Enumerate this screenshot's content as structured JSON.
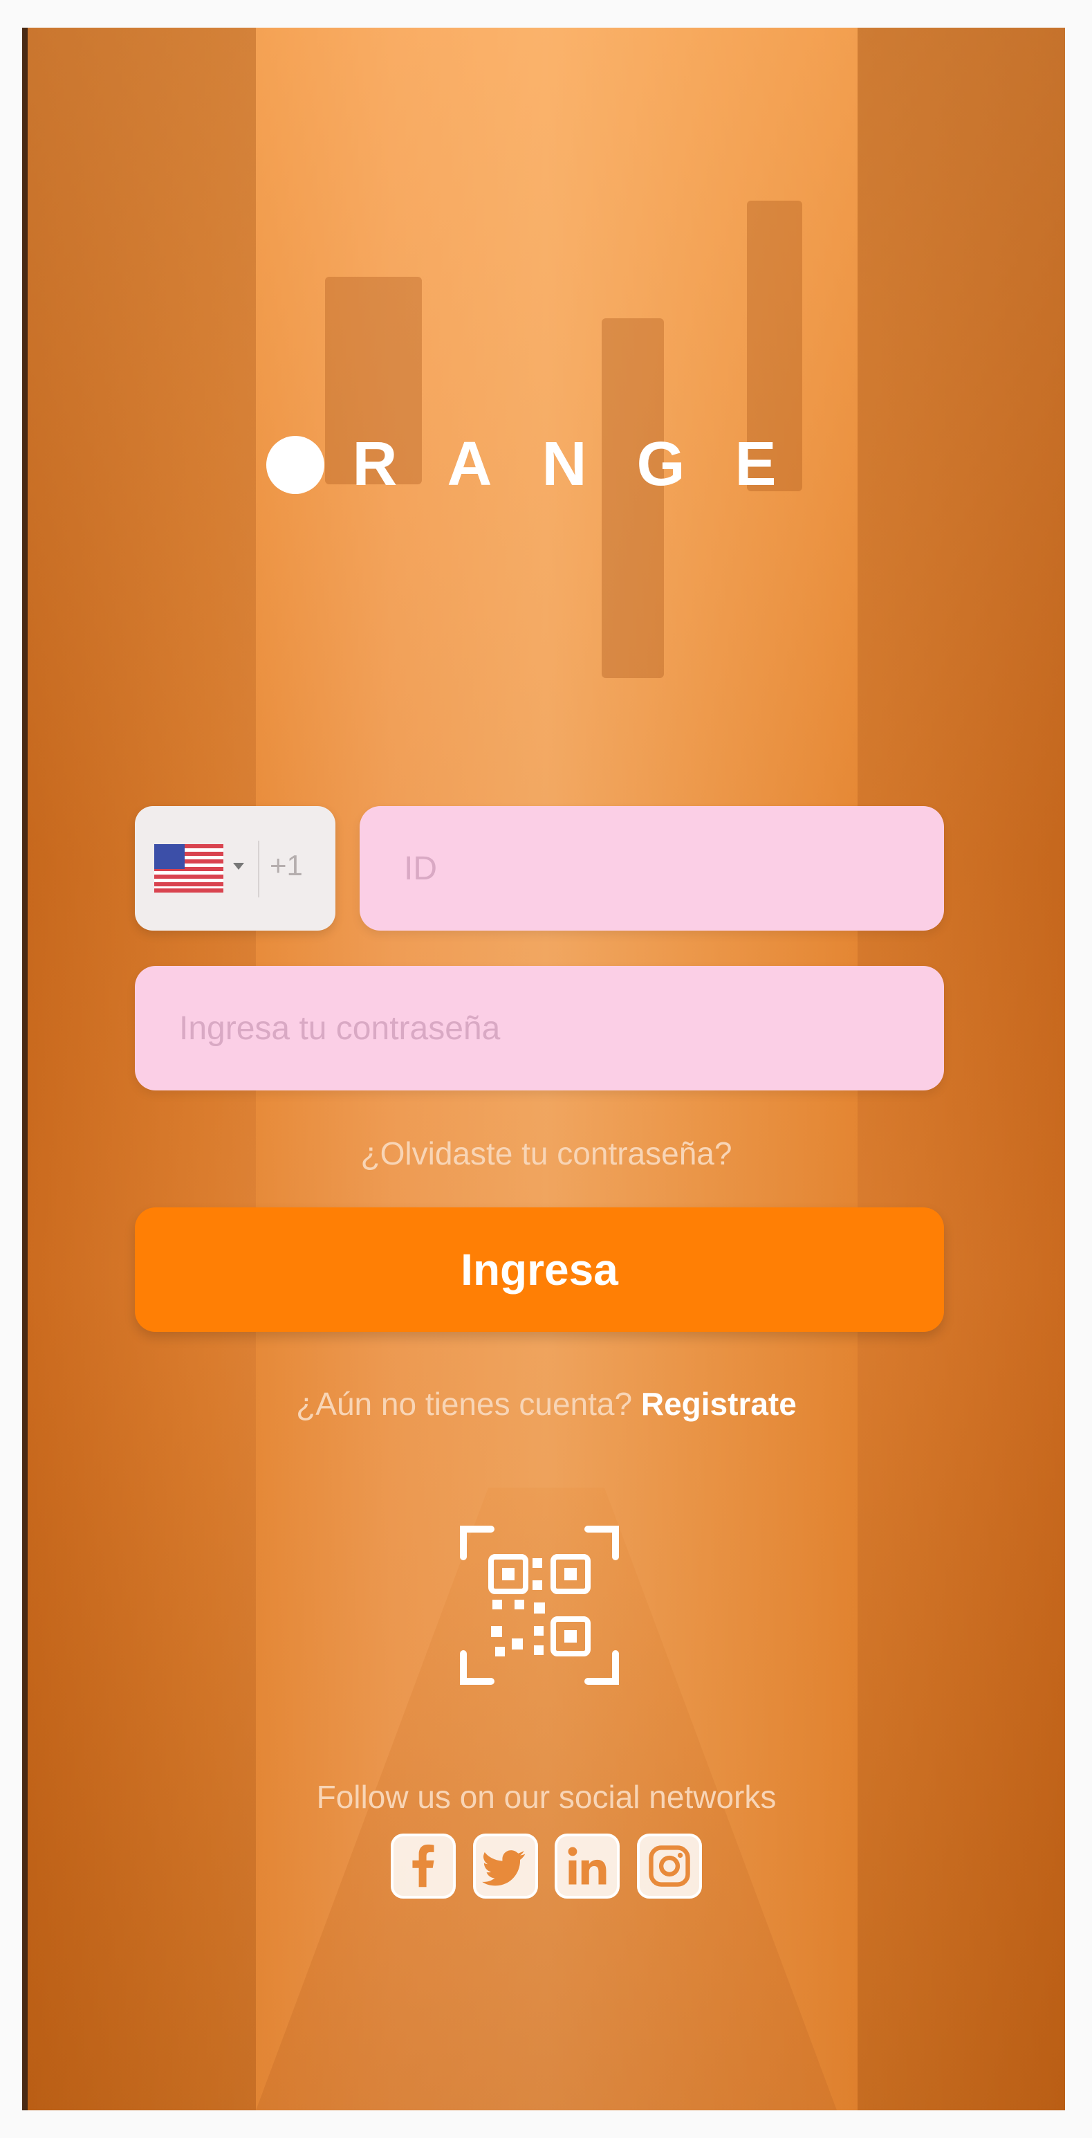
{
  "brand": {
    "logo_text": "RANGE",
    "logo_dot_icon": "circle-logo-mark"
  },
  "login": {
    "country_code": "+1",
    "country_flag": "us-flag-icon",
    "id_placeholder": "ID",
    "password_placeholder": "Ingresa tu contraseña",
    "forgot_password": "¿Olvidaste tu contraseña?",
    "submit_label": "Ingresa"
  },
  "signup": {
    "prompt": "¿Aún no tienes cuenta?",
    "link": "Registrate"
  },
  "qr": {
    "icon": "qr-scan-icon"
  },
  "social": {
    "title": "Follow us on our social networks",
    "icons": [
      "facebook-icon",
      "twitter-icon",
      "linkedin-icon",
      "instagram-icon"
    ]
  },
  "colors": {
    "accent": "#ff7f05",
    "input_bg": "#fbcfe6",
    "overlay": "#e88a3a"
  }
}
